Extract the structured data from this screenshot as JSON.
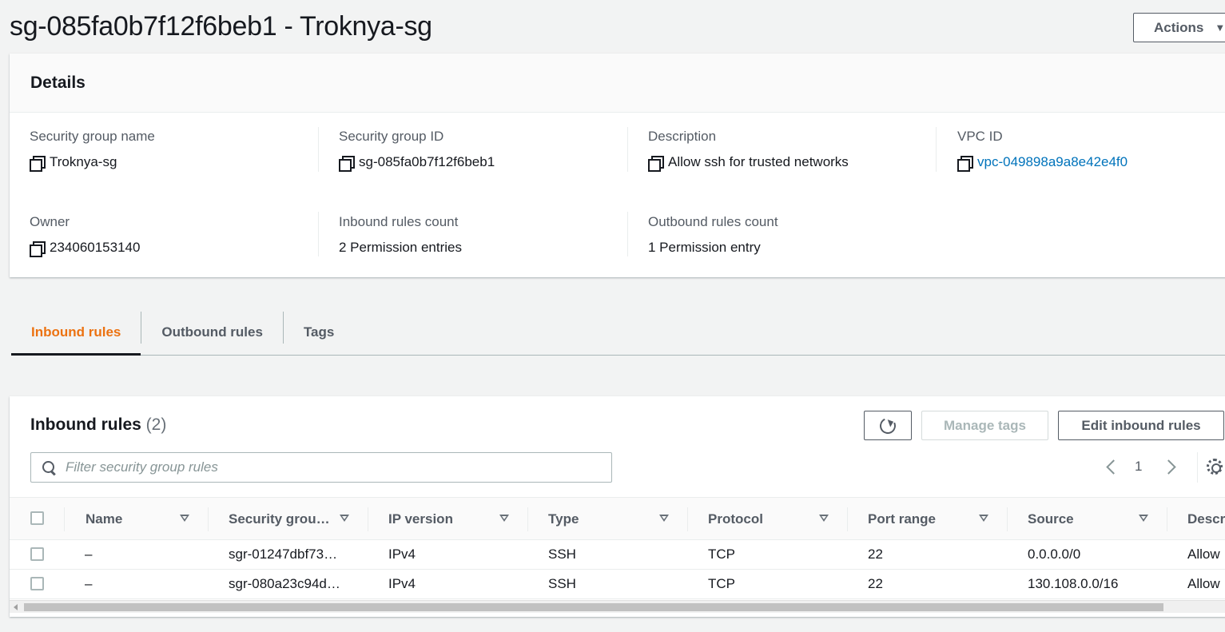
{
  "page": {
    "title": "sg-085fa0b7f12f6beb1 - Troknya-sg",
    "actions_label": "Actions"
  },
  "details": {
    "header": "Details",
    "fields": [
      {
        "label": "Security group name",
        "value": "Troknya-sg",
        "copyable": true,
        "link": false
      },
      {
        "label": "Security group ID",
        "value": "sg-085fa0b7f12f6beb1",
        "copyable": true,
        "link": false
      },
      {
        "label": "Description",
        "value": "Allow ssh for trusted networks",
        "copyable": true,
        "link": false
      },
      {
        "label": "VPC ID",
        "value": "vpc-049898a9a8e42e4f0",
        "copyable": true,
        "link": true
      },
      {
        "label": "Owner",
        "value": "234060153140",
        "copyable": true,
        "link": false
      },
      {
        "label": "Inbound rules count",
        "value": "2 Permission entries",
        "copyable": false,
        "link": false
      },
      {
        "label": "Outbound rules count",
        "value": "1 Permission entry",
        "copyable": false,
        "link": false
      }
    ]
  },
  "tabs": [
    {
      "label": "Inbound rules",
      "active": true
    },
    {
      "label": "Outbound rules",
      "active": false
    },
    {
      "label": "Tags",
      "active": false
    }
  ],
  "inbound": {
    "title": "Inbound rules",
    "count": "(2)",
    "manage_tags_label": "Manage tags",
    "edit_label": "Edit inbound rules",
    "filter_placeholder": "Filter security group rules",
    "page_number": "1",
    "columns": [
      "Name",
      "Security grou…",
      "IP version",
      "Type",
      "Protocol",
      "Port range",
      "Source",
      "Descr"
    ],
    "rows": [
      {
        "name": "–",
        "sgr": "sgr-01247dbf73…",
        "ip": "IPv4",
        "type": "SSH",
        "protocol": "TCP",
        "port": "22",
        "source": "0.0.0.0/0",
        "desc": "Allow"
      },
      {
        "name": "–",
        "sgr": "sgr-080a23c94d…",
        "ip": "IPv4",
        "type": "SSH",
        "protocol": "TCP",
        "port": "22",
        "source": "130.108.0.0/16",
        "desc": "Allow"
      }
    ]
  },
  "colors": {
    "accent": "#ec7211",
    "link": "#0073bb",
    "text": "#16191f",
    "muted": "#545b64"
  }
}
